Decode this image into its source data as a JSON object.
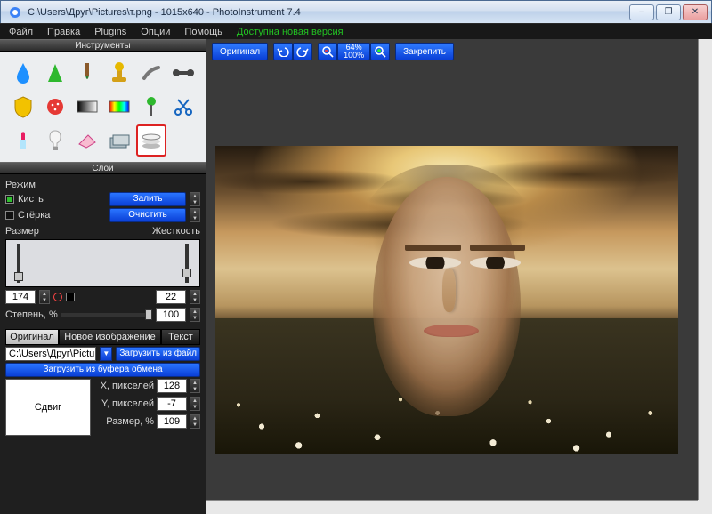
{
  "window": {
    "title": "C:\\Users\\Друг\\Pictures\\т.png - 1015x640 - PhotoInstrument 7.4",
    "buttons": {
      "min": "–",
      "max": "❐",
      "close": "✕"
    }
  },
  "menu": {
    "items": [
      "Файл",
      "Правка",
      "Plugins",
      "Опции",
      "Помощь"
    ],
    "update": "Доступна новая версия"
  },
  "tools_panel": {
    "title": "Инструменты"
  },
  "layers_panel": {
    "title": "Слои",
    "mode_label": "Режим",
    "brush_label": "Кисть",
    "eraser_label": "Стёрка",
    "fill_btn": "Залить",
    "clear_btn": "Очистить",
    "size_label": "Размер",
    "hardness_label": "Жесткость",
    "size_value": "174",
    "hardness_value": "22",
    "degree_label": "Степень, %",
    "degree_value": "100",
    "tabs": {
      "original": "Оригинал",
      "newimage": "Новое изображение",
      "text": "Текст"
    },
    "path_value": "C:\\Users\\Друг\\Pictures\\foto na ▾",
    "load_file_btn": "Загрузить из файл",
    "load_clip_btn": "Загрузить из буфера обмена",
    "shift_label": "Сдвиг",
    "x_label": "X, пикселей",
    "y_label": "Y, пикселей",
    "scale_label": "Размер, %",
    "x_value": "128",
    "y_value": "-7",
    "scale_value": "109"
  },
  "topbar": {
    "original": "Оригинал",
    "zoom_top": "64%",
    "zoom_bottom": "100%",
    "pin": "Закрепить"
  }
}
